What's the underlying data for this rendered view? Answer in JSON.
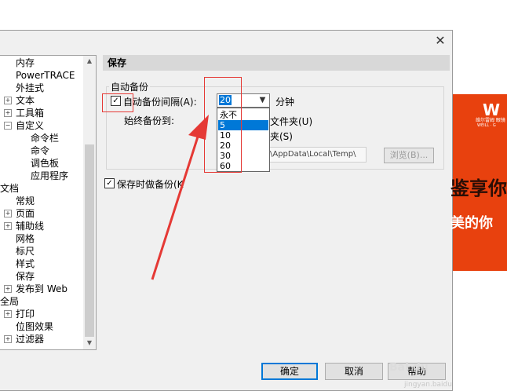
{
  "tree": {
    "items": [
      {
        "label": "内存",
        "indent": 20,
        "expander": false
      },
      {
        "label": "PowerTRACE",
        "indent": 20,
        "expander": false
      },
      {
        "label": "外挂式",
        "indent": 20,
        "expander": false
      },
      {
        "label": "文本",
        "indent": 20,
        "expander": "+"
      },
      {
        "label": "工具箱",
        "indent": 20,
        "expander": "+"
      },
      {
        "label": "自定义",
        "indent": 20,
        "expander": "-"
      },
      {
        "label": "命令栏",
        "indent": 39,
        "expander": false
      },
      {
        "label": "命令",
        "indent": 39,
        "expander": false
      },
      {
        "label": "调色板",
        "indent": 39,
        "expander": false
      },
      {
        "label": "应用程序",
        "indent": 39,
        "expander": false
      },
      {
        "label": "文档",
        "indent": 0,
        "expander": false
      },
      {
        "label": "常规",
        "indent": 20,
        "expander": false
      },
      {
        "label": "页面",
        "indent": 20,
        "expander": "+"
      },
      {
        "label": "辅助线",
        "indent": 20,
        "expander": "+"
      },
      {
        "label": "网格",
        "indent": 20,
        "expander": false
      },
      {
        "label": "标尺",
        "indent": 20,
        "expander": false
      },
      {
        "label": "样式",
        "indent": 20,
        "expander": false
      },
      {
        "label": "保存",
        "indent": 20,
        "expander": false
      },
      {
        "label": "发布到 Web",
        "indent": 20,
        "expander": "+"
      },
      {
        "label": "全局",
        "indent": 0,
        "expander": false
      },
      {
        "label": "打印",
        "indent": 20,
        "expander": "+"
      },
      {
        "label": "位图效果",
        "indent": 20,
        "expander": false
      },
      {
        "label": "过滤器",
        "indent": 20,
        "expander": "+"
      }
    ]
  },
  "panel": {
    "header": "保存",
    "group_label": "自动备份",
    "auto_backup_label": "自动备份间隔(A):",
    "auto_backup_checked": true,
    "interval_value": "20",
    "unit_label": "分钟",
    "always_backup_label": "始终备份到:",
    "folder_radio_label": "文件夹(U)",
    "specific_folder_label": "夹(S)",
    "path_value": "\\AppData\\Local\\Temp\\",
    "browse_label": "浏览(B)...",
    "save_backup_label": "保存时做备份(K",
    "save_backup_checked": true,
    "dropdown_options": [
      "永不",
      "5",
      "10",
      "20",
      "30",
      "60"
    ],
    "dropdown_selected": "5"
  },
  "buttons": {
    "ok": "确定",
    "cancel": "取消",
    "help": "帮助"
  },
  "banner": {
    "logo": "W",
    "brand": "维尔雷姆 眼镜",
    "brand_sub": "WEILL · G",
    "art_text": "鉴享你",
    "tagline": "美的你"
  },
  "watermark": {
    "main": "Bai du",
    "sub": "jingyan.baidu"
  },
  "colors": {
    "accent": "#0078d7",
    "annotation": "#e53935",
    "banner": "#e8410e"
  }
}
